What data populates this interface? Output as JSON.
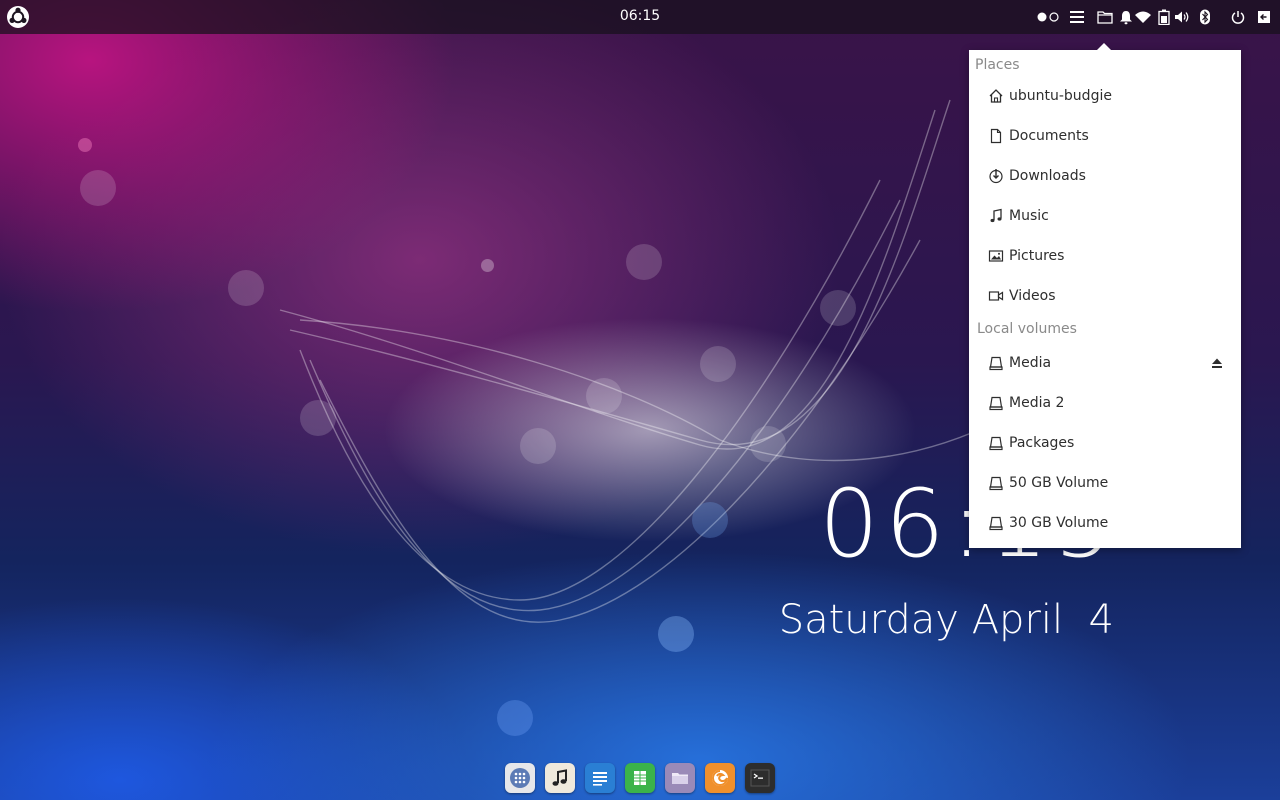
{
  "panel": {
    "clock": "06:15",
    "menu_icon": "ubuntu-budgie-logo-icon",
    "tray_icons": [
      "workspace-switcher-icon",
      "menu-lines-icon",
      "places-folder-icon",
      "notification-bell-icon",
      "wifi-icon",
      "battery-icon",
      "volume-icon",
      "bluetooth-icon",
      "power-icon",
      "logout-icon"
    ]
  },
  "desktop_clock": {
    "time": "06:15",
    "date": "Saturday April  4"
  },
  "places": {
    "header": "Places",
    "items": [
      {
        "label": "ubuntu-budgie",
        "icon": "home-icon"
      },
      {
        "label": "Documents",
        "icon": "document-icon"
      },
      {
        "label": "Downloads",
        "icon": "download-icon"
      },
      {
        "label": "Music",
        "icon": "music-note-icon"
      },
      {
        "label": "Pictures",
        "icon": "picture-icon"
      },
      {
        "label": "Videos",
        "icon": "video-camera-icon"
      }
    ]
  },
  "volumes": {
    "header": "Local volumes",
    "items": [
      {
        "label": "Media",
        "icon": "drive-icon",
        "mounted": true
      },
      {
        "label": "Media 2",
        "icon": "drive-icon"
      },
      {
        "label": "Packages",
        "icon": "drive-icon"
      },
      {
        "label": "50 GB Volume",
        "icon": "drive-icon"
      },
      {
        "label": "30 GB Volume",
        "icon": "drive-icon"
      }
    ]
  },
  "dock": {
    "apps": [
      {
        "name": "app-launcher",
        "color": "#e9e9ec"
      },
      {
        "name": "music-player",
        "color": "#efe9dc"
      },
      {
        "name": "text-editor",
        "color": "#2a7fd4"
      },
      {
        "name": "spreadsheet",
        "color": "#3bb34a"
      },
      {
        "name": "files",
        "color": "#9a8ab8"
      },
      {
        "name": "firefox",
        "color": "#f0902c"
      },
      {
        "name": "terminal",
        "color": "#2d2d2d"
      }
    ]
  },
  "colors": {
    "panel_bg": "#16101c",
    "popover_bg": "#ffffff",
    "section_header": "#8a8a8a",
    "item_text": "#2e2e2e"
  }
}
